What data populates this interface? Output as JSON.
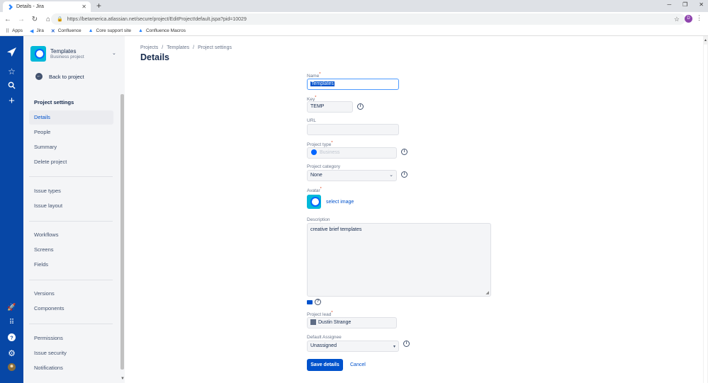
{
  "browser": {
    "tab_title": "Details - Jira",
    "url": "https://betamerica.atlassian.net/secure/project/EditProject!default.jspa?pid=10029",
    "profile_initial": "D",
    "bookmarks": [
      "Apps",
      "Jira",
      "Confluence",
      "Core support site",
      "Confluence Macros"
    ]
  },
  "project": {
    "name": "Templates",
    "type": "Business project",
    "back_label": "Back to project"
  },
  "sidebar": {
    "heading": "Project settings",
    "items": [
      "Details",
      "People",
      "Summary",
      "Delete project",
      "Issue types",
      "Issue layout",
      "Workflows",
      "Screens",
      "Fields",
      "Versions",
      "Components",
      "Permissions",
      "Issue security",
      "Notifications"
    ],
    "active": "Details"
  },
  "breadcrumb": [
    "Projects",
    "/",
    "Templates",
    "/",
    "Project settings"
  ],
  "page_title": "Details",
  "form": {
    "name_label": "Name",
    "name_value": "Templates",
    "key_label": "Key",
    "key_value": "TEMP",
    "url_label": "URL",
    "url_value": "",
    "project_type_label": "Project type",
    "project_type_value": "Business",
    "category_label": "Project category",
    "category_value": "None",
    "avatar_label": "Avatar",
    "select_image": "select image",
    "description_label": "Description",
    "description_value": "creative brief templates",
    "lead_label": "Project lead",
    "lead_value": "Dustin Strange",
    "assignee_label": "Default Assignee",
    "assignee_value": "Unassigned",
    "save_label": "Save details",
    "cancel_label": "Cancel",
    "required_mark": "*"
  },
  "colors": {
    "global_nav": "#0747A6",
    "primary": "#0052CC",
    "sidebar_bg": "#F4F5F7",
    "required": "#DE350B"
  }
}
